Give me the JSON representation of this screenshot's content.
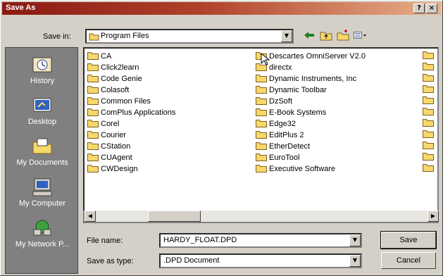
{
  "window": {
    "title": "Save As"
  },
  "titlebar": {
    "help": "?",
    "close": "×"
  },
  "save_in": {
    "label": "Save in:",
    "value": "Program Files"
  },
  "places": [
    {
      "label": "History",
      "icon": "history-icon"
    },
    {
      "label": "Desktop",
      "icon": "desktop-icon"
    },
    {
      "label": "My Documents",
      "icon": "my-documents-icon"
    },
    {
      "label": "My Computer",
      "icon": "my-computer-icon"
    },
    {
      "label": "My Network P...",
      "icon": "network-places-icon"
    }
  ],
  "files": {
    "col1": [
      "CA",
      "Click2learn",
      "Code Genie",
      "Colasoft",
      "Common Files",
      "ComPlus Applications",
      "Corel",
      "Courier",
      "CStation",
      "CUAgent",
      "CWDesign"
    ],
    "col2": [
      "Descartes OmniServer V2.0",
      "directx",
      "Dynamic Instruments, Inc",
      "Dynamic Toolbar",
      "DzSoft",
      "E-Book Systems",
      "Edge32",
      "EditPlus 2",
      "EtherDetect",
      "EuroTool",
      "Executive Software"
    ]
  },
  "file_name": {
    "label": "File name:",
    "value": "HARDY_FLOAT.DPD"
  },
  "save_as_type": {
    "label": "Save as type:",
    "value": ".DPD Document"
  },
  "buttons": {
    "save": "Save",
    "cancel": "Cancel"
  },
  "colors": {
    "title_start": "#8a1a12",
    "title_end": "#e8b08a",
    "face": "#d4d0c8",
    "folder": "#f6d86b"
  }
}
